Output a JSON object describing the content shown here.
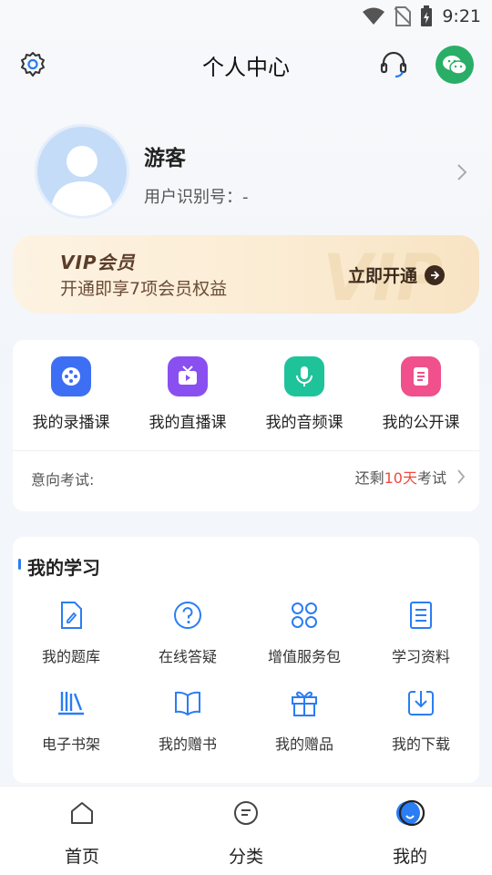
{
  "status_bar": {
    "time": "9:21"
  },
  "header": {
    "title": "个人中心"
  },
  "profile": {
    "name": "游客",
    "uid_label": "用户识别号：-"
  },
  "vip": {
    "title": "VIP会员",
    "subtitle": "开通即享7项会员权益",
    "button": "立即开通",
    "watermark": "VIP"
  },
  "courses": {
    "items": [
      {
        "label": "我的录播课",
        "icon": "recorded-course-icon",
        "color": "#3d6ff5"
      },
      {
        "label": "我的直播课",
        "icon": "live-course-icon",
        "color": "#8a4ff0"
      },
      {
        "label": "我的音频课",
        "icon": "audio-course-icon",
        "color": "#1fc39a"
      },
      {
        "label": "我的公开课",
        "icon": "open-course-icon",
        "color": "#f0508c"
      }
    ],
    "exam_label": "意向考试:",
    "exam_prefix": "还剩",
    "exam_days": "10天",
    "exam_suffix": "考试"
  },
  "study": {
    "title": "我的学习",
    "items": [
      {
        "label": "我的题库",
        "icon": "question-bank-icon"
      },
      {
        "label": "在线答疑",
        "icon": "help-icon"
      },
      {
        "label": "增值服务包",
        "icon": "service-pack-icon"
      },
      {
        "label": "学习资料",
        "icon": "materials-icon"
      },
      {
        "label": "电子书架",
        "icon": "bookshelf-icon"
      },
      {
        "label": "我的赠书",
        "icon": "gift-book-icon"
      },
      {
        "label": "我的赠品",
        "icon": "gift-icon"
      },
      {
        "label": "我的下载",
        "icon": "download-icon"
      }
    ]
  },
  "bottom_nav": {
    "items": [
      {
        "label": "首页",
        "icon": "home-icon"
      },
      {
        "label": "分类",
        "icon": "category-icon"
      },
      {
        "label": "我的",
        "icon": "profile-icon",
        "active": true
      }
    ]
  },
  "colors": {
    "accent": "#2a7df3",
    "wechat": "#2aae67",
    "highlight": "#f04a3a"
  }
}
